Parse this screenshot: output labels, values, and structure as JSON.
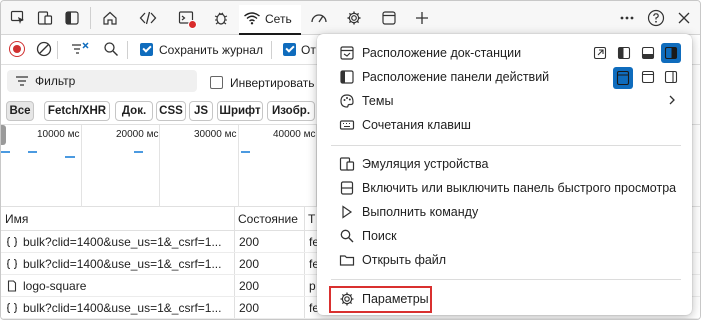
{
  "tabbar": {
    "icons": [
      "inspect-icon",
      "device-emulation-icon",
      "sidebar-toggle-icon",
      "welcome-icon",
      "elements-icon",
      "console-icon",
      "sources-bug-icon",
      "network-wifi-icon",
      "performance-icon",
      "settings-gear-icon",
      "application-icon",
      "add-tab-icon",
      "more-icon",
      "help-icon",
      "close-icon"
    ],
    "network_tab_label": "Сеть"
  },
  "toolbar": {
    "preserve_log_label": "Сохранить журнал",
    "disable_cache_label": "От"
  },
  "filter": {
    "placeholder_label": "Фильтр",
    "invert_label": "Инвертировать"
  },
  "type_chips": [
    "Все",
    "Fetch/XHR",
    "Док.",
    "CSS",
    "JS",
    "Шрифт",
    "Изобр."
  ],
  "timeline": {
    "ticks": [
      "10000 мс",
      "20000 мс",
      "30000 мс",
      "40000 мс"
    ]
  },
  "table": {
    "headers": {
      "name": "Имя",
      "status": "Состояние",
      "type": "Т"
    },
    "rows": [
      {
        "name": "bulk?clid=1400&use_us=1&_csrf=1...",
        "status": "200",
        "type": "fe"
      },
      {
        "name": "bulk?clid=1400&use_us=1&_csrf=1...",
        "status": "200",
        "type": "fe"
      },
      {
        "name": "logo-square",
        "status": "200",
        "type": "p"
      },
      {
        "name": "bulk?clid=1400&use_us=1&_csrf=1...",
        "status": "200",
        "type": "fe"
      }
    ]
  },
  "menu": {
    "dock_label": "Расположение док-станции",
    "activity_bar_label": "Расположение панели действий",
    "themes_label": "Темы",
    "shortcuts_label": "Сочетания клавиш",
    "device_emulation_label": "Эмуляция устройства",
    "quick_view_label": "Включить или выключить панель быстрого просмотра",
    "run_command_label": "Выполнить команду",
    "search_label": "Поиск",
    "open_file_label": "Открыть файл",
    "settings_label": "Параметры"
  },
  "colors": {
    "accent": "#0f6cbd",
    "record": "#d03030",
    "highlight": "#d9302f"
  }
}
